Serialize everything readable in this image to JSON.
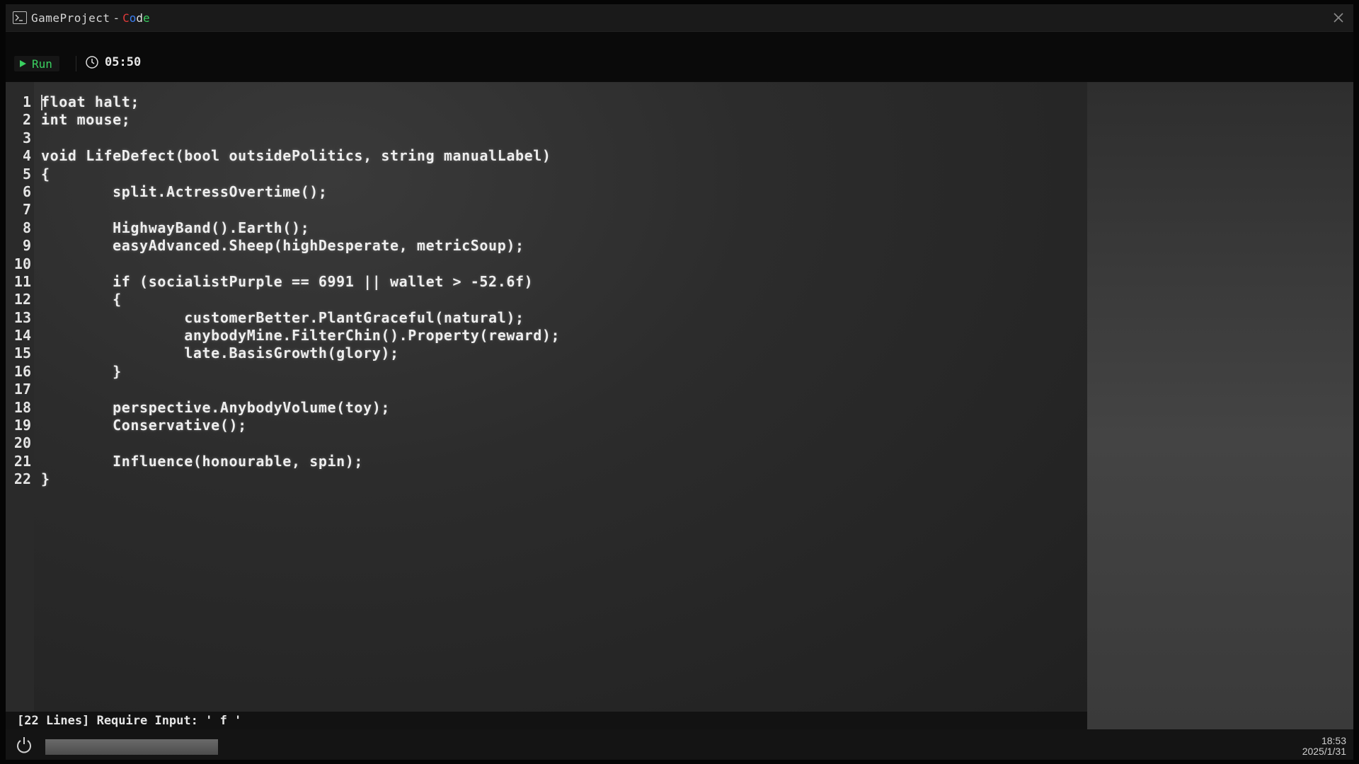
{
  "window": {
    "title": "GameProject",
    "separator": "-",
    "brand": [
      "C",
      "o",
      "d",
      "e"
    ]
  },
  "toolbar": {
    "run_label": "Run",
    "timer": "05:50"
  },
  "editor": {
    "line_numbers": [
      "1",
      "2",
      "3",
      "4",
      "5",
      "6",
      "7",
      "8",
      "9",
      "10",
      "11",
      "12",
      "13",
      "14",
      "15",
      "16",
      "17",
      "18",
      "19",
      "20",
      "21",
      "22"
    ],
    "lines": [
      "float halt;",
      "int mouse;",
      "",
      "void LifeDefect(bool outsidePolitics, string manualLabel)",
      "{",
      "        split.ActressOvertime();",
      "",
      "        HighwayBand().Earth();",
      "        easyAdvanced.Sheep(highDesperate, metricSoup);",
      "",
      "        if (socialistPurple == 6991 || wallet > -52.6f)",
      "        {",
      "                customerBetter.PlantGraceful(natural);",
      "                anybodyMine.FilterChin().Property(reward);",
      "                late.BasisGrowth(glory);",
      "        }",
      "",
      "        perspective.AnybodyVolume(toy);",
      "        Conservative();",
      "",
      "        Influence(honourable, spin);",
      "}"
    ]
  },
  "status": {
    "text": "[22 Lines] Require Input: ' f '"
  },
  "taskbar": {
    "progress": 1.0,
    "time": "18:53",
    "date": "2025/1/31"
  },
  "colors": {
    "run_green": "#3ad060",
    "brand_red": "#e03a3a",
    "brand_blue": "#3a7df0",
    "brand_green": "#3ad060"
  }
}
